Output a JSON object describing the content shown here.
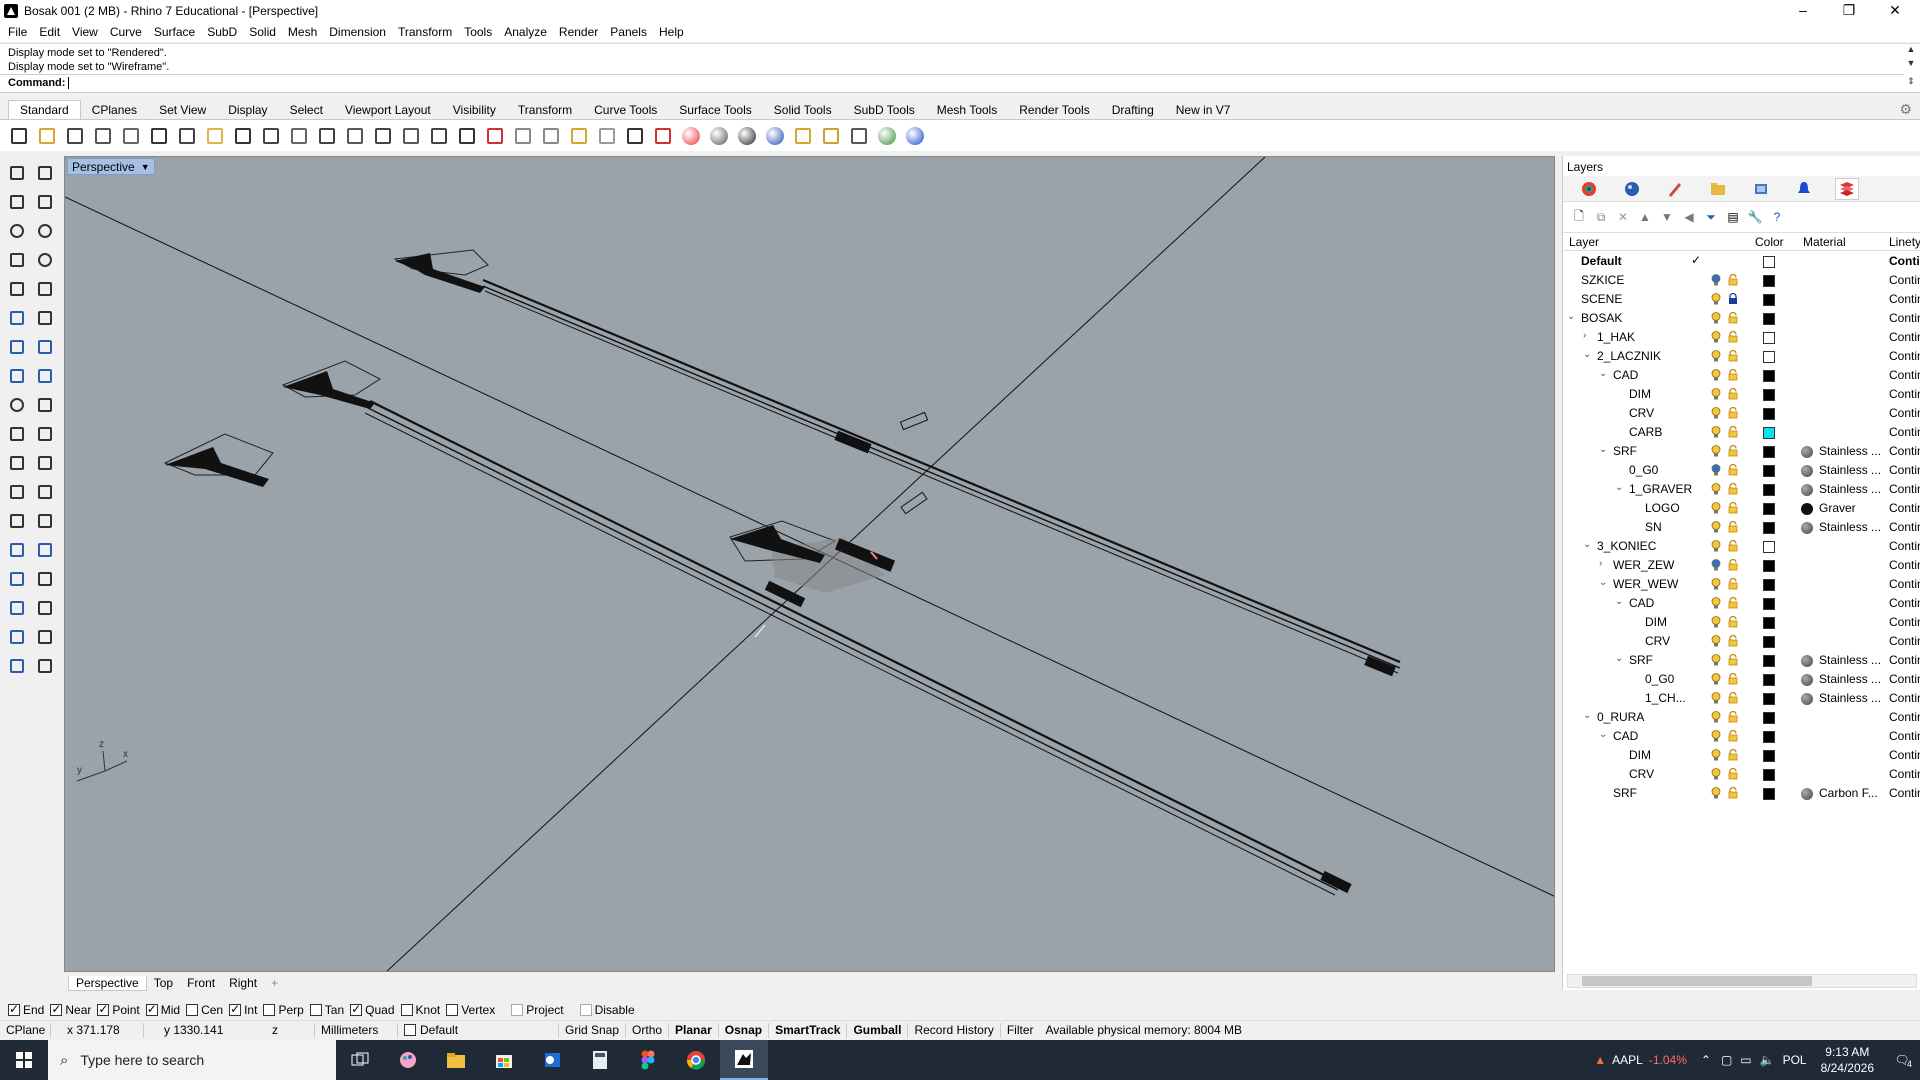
{
  "window": {
    "title": "Bosak 001 (2 MB) - Rhino 7 Educational - [Perspective]"
  },
  "menu": [
    "File",
    "Edit",
    "View",
    "Curve",
    "Surface",
    "SubD",
    "Solid",
    "Mesh",
    "Dimension",
    "Transform",
    "Tools",
    "Analyze",
    "Render",
    "Panels",
    "Help"
  ],
  "command": {
    "history": [
      "Display mode set to \"Rendered\".",
      "Display mode set to \"Wireframe\"."
    ],
    "prompt": "Command:"
  },
  "toolbar_tabs": [
    "Standard",
    "CPlanes",
    "Set View",
    "Display",
    "Select",
    "Viewport Layout",
    "Visibility",
    "Transform",
    "Curve Tools",
    "Surface Tools",
    "Solid Tools",
    "SubD Tools",
    "Mesh Tools",
    "Render Tools",
    "Drafting",
    "New in V7"
  ],
  "toolbar_icons": [
    "new-icon",
    "open-icon",
    "save-icon",
    "print-icon",
    "import-icon",
    "cut-icon",
    "copy-icon",
    "paste-icon",
    "undo-icon",
    "pan-icon",
    "move-view-icon",
    "zoom-dynamic-icon",
    "zoom-window-icon",
    "zoom-extents-icon",
    "zoom-selected-icon",
    "rotate-view-icon",
    "four-viewports-icon",
    "car-icon",
    "car-2-icon",
    "cplane-icon",
    "grid-snap-icon",
    "light-icon",
    "lock-icon",
    "shield-icon",
    "color-wheel-icon",
    "sphere-icon",
    "sphere-dark-icon",
    "sphere-blue-icon",
    "filter-icon",
    "gear-icon",
    "analyze-icon",
    "globe-icon",
    "help-icon"
  ],
  "viewport": {
    "name": "Perspective",
    "tabs": [
      "Perspective",
      "Top",
      "Front",
      "Right"
    ]
  },
  "osnaps": [
    {
      "label": "End",
      "checked": true
    },
    {
      "label": "Near",
      "checked": true
    },
    {
      "label": "Point",
      "checked": true
    },
    {
      "label": "Mid",
      "checked": true
    },
    {
      "label": "Cen",
      "checked": false
    },
    {
      "label": "Int",
      "checked": true
    },
    {
      "label": "Perp",
      "checked": false
    },
    {
      "label": "Tan",
      "checked": false
    },
    {
      "label": "Quad",
      "checked": true
    },
    {
      "label": "Knot",
      "checked": false
    },
    {
      "label": "Vertex",
      "checked": false
    },
    {
      "label": "Project",
      "checked": false,
      "disabled": true
    },
    {
      "label": "Disable",
      "checked": false,
      "disabled": true
    }
  ],
  "status": {
    "cplane": "CPlane",
    "x": "x 371.178",
    "y": "y 1330.141",
    "z": "z",
    "units": "Millimeters",
    "layer": "Default",
    "grid_snap": "Grid Snap",
    "ortho": "Ortho",
    "planar": "Planar",
    "osnap": "Osnap",
    "smarttrack": "SmartTrack",
    "gumball": "Gumball",
    "record_history": "Record History",
    "filter": "Filter",
    "memory": "Available physical memory: 8004 MB"
  },
  "layers_panel": {
    "title": "Layers",
    "columns": {
      "layer": "Layer",
      "color": "Color",
      "material": "Material",
      "linetype": "Linety"
    },
    "rows": [
      {
        "name": "Default",
        "depth": 0,
        "twisty": "",
        "color": "#ffffff",
        "material": "",
        "linetype": "Contin",
        "current": true
      },
      {
        "name": "SZKICE",
        "depth": 0,
        "twisty": "",
        "color": "#000000",
        "material": "",
        "linetype": "Contin",
        "bulb_blue": true
      },
      {
        "name": "SCENE",
        "depth": 0,
        "twisty": "",
        "color": "#000000",
        "material": "",
        "linetype": "Contin",
        "locked": true
      },
      {
        "name": "BOSAK",
        "depth": 0,
        "twisty": "v",
        "color": "#000000",
        "material": "",
        "linetype": "Contin"
      },
      {
        "name": "1_HAK",
        "depth": 1,
        "twisty": ">",
        "color": "#ffffff",
        "material": "",
        "linetype": "Contin"
      },
      {
        "name": "2_LACZNIK",
        "depth": 1,
        "twisty": "v",
        "color": "#ffffff",
        "material": "",
        "linetype": "Contin"
      },
      {
        "name": "CAD",
        "depth": 2,
        "twisty": "v",
        "color": "#000000",
        "material": "",
        "linetype": "Contin"
      },
      {
        "name": "DIM",
        "depth": 3,
        "twisty": "",
        "color": "#000000",
        "material": "",
        "linetype": "Contin"
      },
      {
        "name": "CRV",
        "depth": 3,
        "twisty": "",
        "color": "#000000",
        "material": "",
        "linetype": "Contin"
      },
      {
        "name": "CARB",
        "depth": 3,
        "twisty": "",
        "color": "#00e5ee",
        "material": "",
        "linetype": "Contin"
      },
      {
        "name": "SRF",
        "depth": 2,
        "twisty": "v",
        "color": "#000000",
        "material": "Stainless ...",
        "linetype": "Contin"
      },
      {
        "name": "0_G0",
        "depth": 3,
        "twisty": "",
        "color": "#000000",
        "material": "Stainless ...",
        "linetype": "Contin",
        "bulb_blue": true
      },
      {
        "name": "1_GRAVER",
        "depth": 3,
        "twisty": "v",
        "color": "#000000",
        "material": "Stainless ...",
        "linetype": "Contin"
      },
      {
        "name": "LOGO",
        "depth": 4,
        "twisty": "",
        "color": "#000000",
        "material": "Graver",
        "linetype": "Contin",
        "dark_ball": true
      },
      {
        "name": "SN",
        "depth": 4,
        "twisty": "",
        "color": "#000000",
        "material": "Stainless ...",
        "linetype": "Contin"
      },
      {
        "name": "3_KONIEC",
        "depth": 1,
        "twisty": "v",
        "color": "#ffffff",
        "material": "",
        "linetype": "Contin"
      },
      {
        "name": "WER_ZEW",
        "depth": 2,
        "twisty": ">",
        "color": "#000000",
        "material": "",
        "linetype": "Contin",
        "bulb_blue": true
      },
      {
        "name": "WER_WEW",
        "depth": 2,
        "twisty": "v",
        "color": "#000000",
        "material": "",
        "linetype": "Contin"
      },
      {
        "name": "CAD",
        "depth": 3,
        "twisty": "v",
        "color": "#000000",
        "material": "",
        "linetype": "Contin"
      },
      {
        "name": "DIM",
        "depth": 4,
        "twisty": "",
        "color": "#000000",
        "material": "",
        "linetype": "Contin"
      },
      {
        "name": "CRV",
        "depth": 4,
        "twisty": "",
        "color": "#000000",
        "material": "",
        "linetype": "Contin"
      },
      {
        "name": "SRF",
        "depth": 3,
        "twisty": "v",
        "color": "#000000",
        "material": "Stainless ...",
        "linetype": "Contin"
      },
      {
        "name": "0_G0",
        "depth": 4,
        "twisty": "",
        "color": "#000000",
        "material": "Stainless ...",
        "linetype": "Contin"
      },
      {
        "name": "1_CH...",
        "depth": 4,
        "twisty": "",
        "color": "#000000",
        "material": "Stainless ...",
        "linetype": "Contin"
      },
      {
        "name": "0_RURA",
        "depth": 1,
        "twisty": "v",
        "color": "#000000",
        "material": "",
        "linetype": "Contin"
      },
      {
        "name": "CAD",
        "depth": 2,
        "twisty": "v",
        "color": "#000000",
        "material": "",
        "linetype": "Contin"
      },
      {
        "name": "DIM",
        "depth": 3,
        "twisty": "",
        "color": "#000000",
        "material": "",
        "linetype": "Contin"
      },
      {
        "name": "CRV",
        "depth": 3,
        "twisty": "",
        "color": "#000000",
        "material": "",
        "linetype": "Contin"
      },
      {
        "name": "SRF",
        "depth": 2,
        "twisty": "",
        "color": "#000000",
        "material": "Carbon F...",
        "linetype": "Contin"
      }
    ]
  },
  "taskbar": {
    "search_placeholder": "Type here to search",
    "stock": "AAPL",
    "stock_change": "-1.04%",
    "lang": "POL",
    "time": "9:13 AM",
    "date": "8/24/2026",
    "notifications": "4"
  },
  "colors": {
    "viewport_bg": "#9aa2aa",
    "accent": "#a6c0e4",
    "stock_down": "#ff6b6b"
  }
}
